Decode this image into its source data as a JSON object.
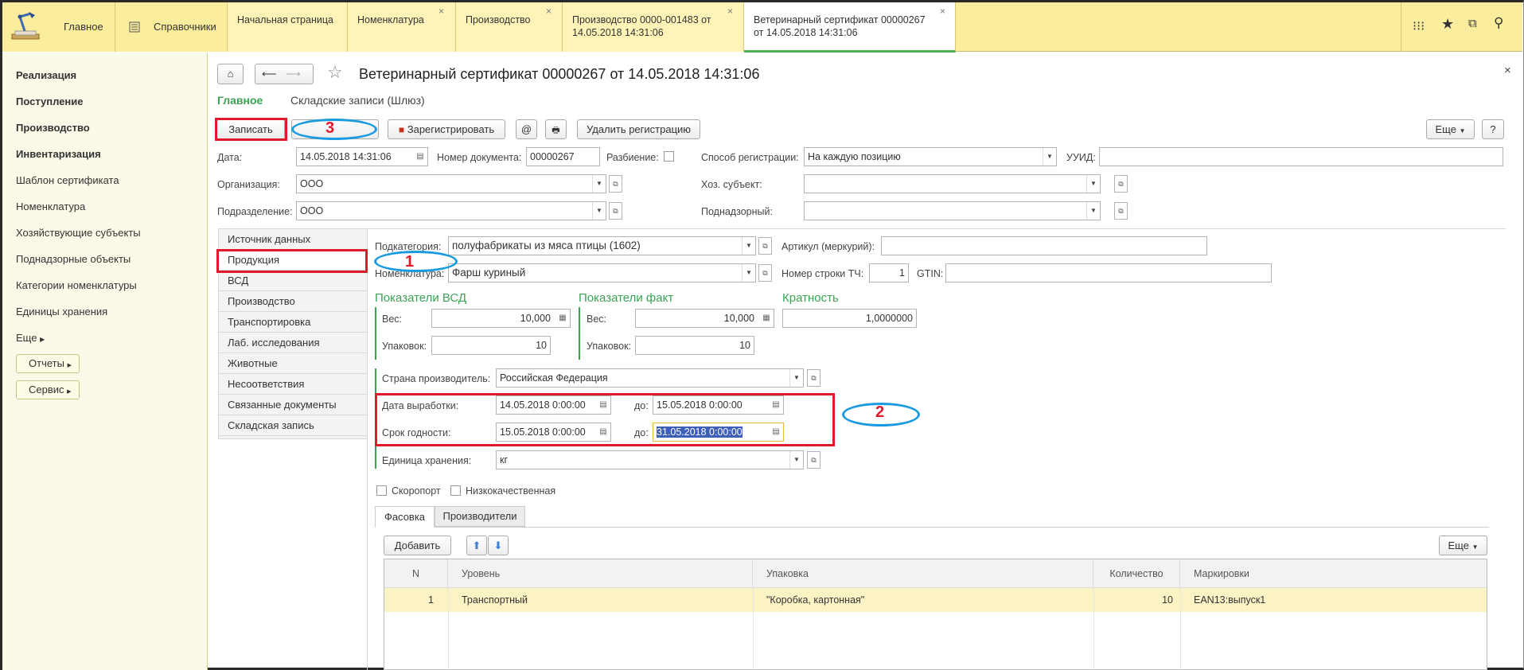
{
  "topbar": {
    "main_label": "Главное",
    "refs_label": "Справочники",
    "tabs": [
      {
        "label": "Начальная страница"
      },
      {
        "label": "Номенклатура"
      },
      {
        "label": "Производство"
      },
      {
        "label": "Производство 0000-001483 от 14.05.2018 14:31:06"
      },
      {
        "label": "Ветеринарный сертификат 00000267 от 14.05.2018 14:31:06"
      }
    ]
  },
  "sidebar": {
    "items": [
      {
        "label": "Реализация"
      },
      {
        "label": "Поступление"
      },
      {
        "label": "Производство"
      },
      {
        "label": "Инвентаризация"
      },
      {
        "label": "Шаблон сертификата"
      },
      {
        "label": "Номенклатура"
      },
      {
        "label": "Хозяйствующие субъекты"
      },
      {
        "label": "Поднадзорные объекты"
      },
      {
        "label": "Категории номенклатуры"
      },
      {
        "label": "Единицы хранения"
      }
    ],
    "more_label": "Еще",
    "reports_label": "Отчеты",
    "service_label": "Сервис"
  },
  "document": {
    "title": "Ветеринарный сертификат 00000267 от 14.05.2018 14:31:06",
    "nav_main": "Главное",
    "nav_warehouse": "Складские записи (Шлюз)"
  },
  "toolbar": {
    "save": "Записать",
    "register": "Зарегистрировать",
    "at": "@",
    "delete_registration": "Удалить регистрацию",
    "more": "Еще",
    "help": "?"
  },
  "header_fields": {
    "date_label": "Дата:",
    "date_value": "14.05.2018 14:31:06",
    "docnum_label": "Номер документа:",
    "docnum_value": "00000267",
    "split_label": "Разбиение:",
    "regmethod_label": "Способ регистрации:",
    "regmethod_value": "На каждую позицию",
    "uuid_label": "УУИД:",
    "uuid_value": "",
    "org_label": "Организация:",
    "org_value": "ООО",
    "subject_label": "Хоз. субъект:",
    "subject_value": "",
    "division_label": "Подразделение:",
    "division_value": "ООО",
    "supervised_label": "Поднадзорный:",
    "supervised_value": ""
  },
  "side_tabs": [
    {
      "label": "Источник данных"
    },
    {
      "label": "Продукция"
    },
    {
      "label": "ВСД"
    },
    {
      "label": "Производство"
    },
    {
      "label": "Транспортировка"
    },
    {
      "label": "Лаб. исследования"
    },
    {
      "label": "Животные"
    },
    {
      "label": "Несоответствия"
    },
    {
      "label": "Связанные документы"
    },
    {
      "label": "Складская запись"
    }
  ],
  "product": {
    "subcategory_label": "Подкатегория:",
    "subcategory_value": "полуфабрикаты из мяса птицы (1602)",
    "article_label": "Артикул (меркурий):",
    "article_value": "",
    "nomenclature_label": "Номенклатура:",
    "nomenclature_value": "Фарш куриный",
    "row_label": "Номер строки ТЧ:",
    "row_value": "1",
    "gtin_label": "GTIN:",
    "gtin_value": "",
    "vsd_title": "Показатели ВСД",
    "fact_title": "Показатели факт",
    "multiplicity_title": "Кратность",
    "weight_label": "Вес:",
    "packs_label": "Упаковок:",
    "vsd_weight": "10,000",
    "vsd_packs": "10",
    "fact_weight": "10,000",
    "fact_packs": "10",
    "multiplicity_value": "1,0000000",
    "country_label": "Страна производитель:",
    "country_value": "Российская Федерация",
    "prod_date_label": "Дата выработки:",
    "prod_date_from": "14.05.2018  0:00:00",
    "to_label": "до:",
    "prod_date_to": "15.05.2018  0:00:00",
    "expiry_label": "Срок годности:",
    "expiry_from": "15.05.2018  0:00:00",
    "expiry_to": "31.05.2018  0:00:00",
    "unit_label": "Единица хранения:",
    "unit_value": "кг",
    "perishable_label": "Скоропорт",
    "lowquality_label": "Низкокачественная"
  },
  "inner_tabs": [
    {
      "label": "Фасовка"
    },
    {
      "label": "Производители"
    }
  ],
  "grid": {
    "add_label": "Добавить",
    "more_label": "Еще",
    "columns": [
      "N",
      "Уровень",
      "Упаковка",
      "Количество",
      "Маркировки"
    ],
    "rows": [
      {
        "n": "1",
        "level": "Транспортный",
        "pack": "\"Коробка, картонная\"",
        "qty": "10",
        "marks": "EAN13:выпуск1"
      }
    ]
  },
  "annotations": {
    "n1": "1",
    "n2": "2",
    "n3": "3"
  },
  "colors": {
    "accent_green": "#3aa354",
    "topbar_yellow": "#fbed9e",
    "annotation_red": "#e01a2a",
    "annotation_blue": "#1a9be0"
  }
}
